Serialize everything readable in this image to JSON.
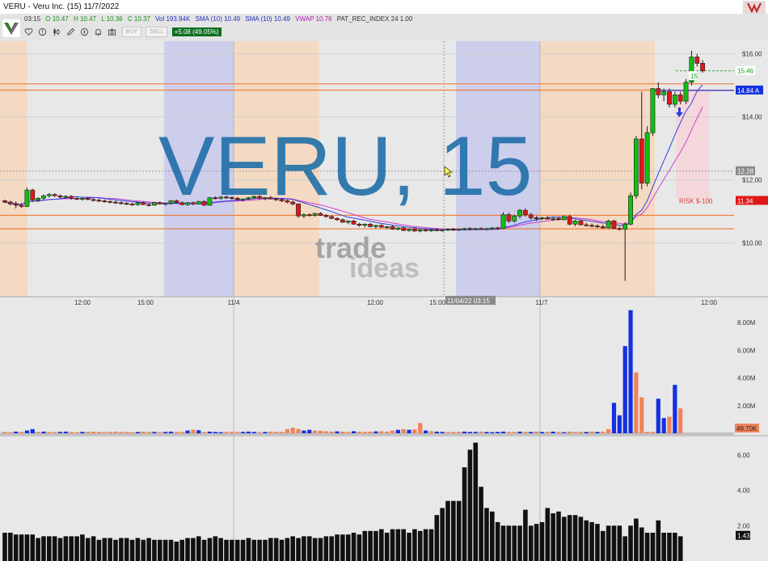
{
  "window": {
    "title": "VERU - Veru Inc. (15) 11/7/2022"
  },
  "quote": {
    "time": "03:15",
    "open": "O 10.47",
    "high": "H 10.47",
    "low": "L 10.36",
    "close": "C 10.37",
    "volume": "Vol 193.94K",
    "sma1": "SMA (10) 10.49",
    "sma2": "SMA (10) 10.49",
    "vwap": "VWAP 10.76",
    "pat": "PAT_REC_INDEX 24 1.00"
  },
  "toolbar": {
    "icons": [
      "heart-icon",
      "alert-icon",
      "candlestick-icon",
      "pencil-icon",
      "compass-icon",
      "bell-icon",
      "camera-icon"
    ],
    "buy_label": "BUY",
    "sell_label": "SELL",
    "change": "+5.08 (49.05%)"
  },
  "watermark": {
    "symbol": "VERU, 15",
    "brand_top": "trade",
    "brand_bottom": "ideas"
  },
  "colors": {
    "up": "#11c011",
    "down": "#e01818",
    "volume_up": "#1530e0",
    "volume_down": "#f0825a",
    "sma": "#3040e0",
    "vwap": "#d040d0",
    "level_line": "#f08040",
    "session_pre": "#f6d6bc",
    "session_post": "#c8c8ec"
  },
  "chart_data": {
    "type": "candlestick",
    "symbol": "VERU",
    "interval": "15",
    "price_axis": {
      "ticks": [
        "$16.00",
        "$14.00",
        "$12.00",
        "$10.00"
      ],
      "range": [
        8.3,
        16.4
      ]
    },
    "time_axis": {
      "ticks": [
        "12:00",
        "15:00",
        "11/4",
        "12:00",
        "15:00",
        "11/7",
        "12:00"
      ]
    },
    "crosshair": {
      "time_label": "11/04/22 03:15",
      "price_label": "12.28"
    },
    "price_labels": {
      "last": "15.46",
      "vwap": "14.84 A",
      "risk_price": "11.34",
      "avg_price": "15"
    },
    "risk_label": "RISK $-100",
    "horizontal_levels": [
      15.05,
      14.85,
      10.88,
      10.45
    ],
    "candles": [
      {
        "o": 11.34,
        "h": 11.38,
        "l": 11.26,
        "c": 11.3
      },
      {
        "o": 11.3,
        "h": 11.34,
        "l": 11.2,
        "c": 11.24
      },
      {
        "o": 11.24,
        "h": 11.32,
        "l": 11.1,
        "c": 11.2
      },
      {
        "o": 11.2,
        "h": 11.26,
        "l": 11.12,
        "c": 11.16
      },
      {
        "o": 11.16,
        "h": 11.76,
        "l": 11.14,
        "c": 11.68
      },
      {
        "o": 11.68,
        "h": 11.72,
        "l": 11.3,
        "c": 11.36
      },
      {
        "o": 11.36,
        "h": 11.46,
        "l": 11.3,
        "c": 11.42
      },
      {
        "o": 11.42,
        "h": 11.54,
        "l": 11.36,
        "c": 11.5
      },
      {
        "o": 11.5,
        "h": 11.58,
        "l": 11.44,
        "c": 11.54
      },
      {
        "o": 11.54,
        "h": 11.58,
        "l": 11.46,
        "c": 11.5
      },
      {
        "o": 11.5,
        "h": 11.54,
        "l": 11.42,
        "c": 11.46
      },
      {
        "o": 11.46,
        "h": 11.52,
        "l": 11.4,
        "c": 11.48
      },
      {
        "o": 11.48,
        "h": 11.52,
        "l": 11.38,
        "c": 11.42
      },
      {
        "o": 11.42,
        "h": 11.46,
        "l": 11.36,
        "c": 11.4
      },
      {
        "o": 11.4,
        "h": 11.44,
        "l": 11.34,
        "c": 11.42
      },
      {
        "o": 11.42,
        "h": 11.46,
        "l": 11.36,
        "c": 11.38
      },
      {
        "o": 11.38,
        "h": 11.42,
        "l": 11.32,
        "c": 11.36
      },
      {
        "o": 11.36,
        "h": 11.4,
        "l": 11.3,
        "c": 11.34
      },
      {
        "o": 11.34,
        "h": 11.38,
        "l": 11.28,
        "c": 11.32
      },
      {
        "o": 11.32,
        "h": 11.36,
        "l": 11.26,
        "c": 11.3
      },
      {
        "o": 11.3,
        "h": 11.34,
        "l": 11.24,
        "c": 11.28
      },
      {
        "o": 11.28,
        "h": 11.32,
        "l": 11.22,
        "c": 11.26
      },
      {
        "o": 11.26,
        "h": 11.3,
        "l": 11.2,
        "c": 11.24
      },
      {
        "o": 11.24,
        "h": 11.28,
        "l": 11.18,
        "c": 11.22
      },
      {
        "o": 11.22,
        "h": 11.3,
        "l": 11.18,
        "c": 11.28
      },
      {
        "o": 11.28,
        "h": 11.32,
        "l": 11.2,
        "c": 11.22
      },
      {
        "o": 11.22,
        "h": 11.26,
        "l": 11.16,
        "c": 11.2
      },
      {
        "o": 11.2,
        "h": 11.3,
        "l": 11.18,
        "c": 11.28
      },
      {
        "o": 11.28,
        "h": 11.32,
        "l": 11.22,
        "c": 11.24
      },
      {
        "o": 11.24,
        "h": 11.28,
        "l": 11.18,
        "c": 11.26
      },
      {
        "o": 11.26,
        "h": 11.36,
        "l": 11.22,
        "c": 11.34
      },
      {
        "o": 11.34,
        "h": 11.38,
        "l": 11.26,
        "c": 11.28
      },
      {
        "o": 11.28,
        "h": 11.32,
        "l": 11.2,
        "c": 11.22
      },
      {
        "o": 11.22,
        "h": 11.3,
        "l": 11.18,
        "c": 11.28
      },
      {
        "o": 11.28,
        "h": 11.32,
        "l": 11.2,
        "c": 11.24
      },
      {
        "o": 11.24,
        "h": 11.34,
        "l": 11.22,
        "c": 11.32
      },
      {
        "o": 11.32,
        "h": 11.36,
        "l": 11.18,
        "c": 11.2
      },
      {
        "o": 11.2,
        "h": 11.46,
        "l": 11.18,
        "c": 11.44
      },
      {
        "o": 11.44,
        "h": 11.48,
        "l": 11.38,
        "c": 11.42
      },
      {
        "o": 11.42,
        "h": 11.48,
        "l": 11.38,
        "c": 11.46
      },
      {
        "o": 11.46,
        "h": 11.5,
        "l": 11.4,
        "c": 11.44
      },
      {
        "o": 11.44,
        "h": 11.48,
        "l": 11.38,
        "c": 11.42
      },
      {
        "o": 11.42,
        "h": 11.46,
        "l": 11.34,
        "c": 11.38
      },
      {
        "o": 11.38,
        "h": 11.42,
        "l": 11.32,
        "c": 11.4
      },
      {
        "o": 11.4,
        "h": 11.46,
        "l": 11.36,
        "c": 11.44
      },
      {
        "o": 11.44,
        "h": 11.5,
        "l": 11.4,
        "c": 11.48
      },
      {
        "o": 11.48,
        "h": 11.52,
        "l": 11.38,
        "c": 11.42
      },
      {
        "o": 11.42,
        "h": 11.46,
        "l": 11.36,
        "c": 11.44
      },
      {
        "o": 11.44,
        "h": 11.5,
        "l": 11.38,
        "c": 11.4
      },
      {
        "o": 11.4,
        "h": 11.44,
        "l": 11.34,
        "c": 11.38
      },
      {
        "o": 11.38,
        "h": 11.42,
        "l": 11.3,
        "c": 11.34
      },
      {
        "o": 11.34,
        "h": 11.38,
        "l": 11.26,
        "c": 11.3
      },
      {
        "o": 11.3,
        "h": 11.34,
        "l": 11.2,
        "c": 11.24
      },
      {
        "o": 11.24,
        "h": 11.26,
        "l": 10.8,
        "c": 10.86
      },
      {
        "o": 10.86,
        "h": 10.94,
        "l": 10.8,
        "c": 10.9
      },
      {
        "o": 10.9,
        "h": 10.94,
        "l": 10.84,
        "c": 10.88
      },
      {
        "o": 10.88,
        "h": 10.96,
        "l": 10.84,
        "c": 10.94
      },
      {
        "o": 10.94,
        "h": 10.98,
        "l": 10.86,
        "c": 10.88
      },
      {
        "o": 10.88,
        "h": 10.92,
        "l": 10.8,
        "c": 10.84
      },
      {
        "o": 10.84,
        "h": 10.88,
        "l": 10.76,
        "c": 10.78
      },
      {
        "o": 10.78,
        "h": 10.82,
        "l": 10.7,
        "c": 10.74
      },
      {
        "o": 10.74,
        "h": 10.78,
        "l": 10.64,
        "c": 10.66
      },
      {
        "o": 10.66,
        "h": 10.72,
        "l": 10.6,
        "c": 10.7
      },
      {
        "o": 10.7,
        "h": 10.74,
        "l": 10.58,
        "c": 10.6
      },
      {
        "o": 10.6,
        "h": 10.64,
        "l": 10.52,
        "c": 10.56
      },
      {
        "o": 10.56,
        "h": 10.62,
        "l": 10.5,
        "c": 10.6
      },
      {
        "o": 10.6,
        "h": 10.64,
        "l": 10.5,
        "c": 10.52
      },
      {
        "o": 10.52,
        "h": 10.58,
        "l": 10.46,
        "c": 10.56
      },
      {
        "o": 10.56,
        "h": 10.6,
        "l": 10.48,
        "c": 10.5
      },
      {
        "o": 10.5,
        "h": 10.54,
        "l": 10.44,
        "c": 10.52
      },
      {
        "o": 10.52,
        "h": 10.56,
        "l": 10.42,
        "c": 10.44
      },
      {
        "o": 10.44,
        "h": 10.5,
        "l": 10.4,
        "c": 10.48
      },
      {
        "o": 10.48,
        "h": 10.52,
        "l": 10.38,
        "c": 10.4
      },
      {
        "o": 10.4,
        "h": 10.46,
        "l": 10.36,
        "c": 10.44
      },
      {
        "o": 10.44,
        "h": 10.48,
        "l": 10.36,
        "c": 10.38
      },
      {
        "o": 10.38,
        "h": 10.44,
        "l": 10.34,
        "c": 10.42
      },
      {
        "o": 10.42,
        "h": 10.46,
        "l": 10.36,
        "c": 10.4
      },
      {
        "o": 10.4,
        "h": 10.44,
        "l": 10.36,
        "c": 10.42
      },
      {
        "o": 10.42,
        "h": 10.46,
        "l": 10.38,
        "c": 10.4
      },
      {
        "o": 10.4,
        "h": 10.44,
        "l": 10.36,
        "c": 10.42
      },
      {
        "o": 10.42,
        "h": 10.46,
        "l": 10.38,
        "c": 10.44
      },
      {
        "o": 10.44,
        "h": 10.48,
        "l": 10.38,
        "c": 10.42
      },
      {
        "o": 10.42,
        "h": 10.46,
        "l": 10.38,
        "c": 10.44
      },
      {
        "o": 10.44,
        "h": 10.48,
        "l": 10.4,
        "c": 10.46
      },
      {
        "o": 10.46,
        "h": 10.5,
        "l": 10.4,
        "c": 10.44
      },
      {
        "o": 10.44,
        "h": 10.48,
        "l": 10.4,
        "c": 10.46
      },
      {
        "o": 10.46,
        "h": 10.5,
        "l": 10.42,
        "c": 10.44
      },
      {
        "o": 10.44,
        "h": 10.48,
        "l": 10.4,
        "c": 10.46
      },
      {
        "o": 10.46,
        "h": 10.5,
        "l": 10.42,
        "c": 10.48
      },
      {
        "o": 10.48,
        "h": 10.52,
        "l": 10.42,
        "c": 10.46
      },
      {
        "o": 10.46,
        "h": 10.98,
        "l": 10.44,
        "c": 10.9
      },
      {
        "o": 10.9,
        "h": 10.96,
        "l": 10.64,
        "c": 10.7
      },
      {
        "o": 10.7,
        "h": 10.9,
        "l": 10.64,
        "c": 10.86
      },
      {
        "o": 10.86,
        "h": 11.08,
        "l": 10.78,
        "c": 11.04
      },
      {
        "o": 11.04,
        "h": 11.1,
        "l": 10.84,
        "c": 10.9
      },
      {
        "o": 10.9,
        "h": 10.96,
        "l": 10.74,
        "c": 10.8
      },
      {
        "o": 10.8,
        "h": 10.86,
        "l": 10.7,
        "c": 10.78
      },
      {
        "o": 10.78,
        "h": 10.84,
        "l": 10.72,
        "c": 10.8
      },
      {
        "o": 10.8,
        "h": 10.86,
        "l": 10.74,
        "c": 10.76
      },
      {
        "o": 10.76,
        "h": 10.82,
        "l": 10.7,
        "c": 10.78
      },
      {
        "o": 10.78,
        "h": 10.84,
        "l": 10.72,
        "c": 10.74
      },
      {
        "o": 10.74,
        "h": 10.88,
        "l": 10.72,
        "c": 10.84
      },
      {
        "o": 10.84,
        "h": 10.9,
        "l": 10.56,
        "c": 10.6
      },
      {
        "o": 10.6,
        "h": 10.74,
        "l": 10.54,
        "c": 10.7
      },
      {
        "o": 10.7,
        "h": 10.74,
        "l": 10.56,
        "c": 10.58
      },
      {
        "o": 10.58,
        "h": 10.64,
        "l": 10.52,
        "c": 10.56
      },
      {
        "o": 10.56,
        "h": 10.62,
        "l": 10.5,
        "c": 10.54
      },
      {
        "o": 10.54,
        "h": 10.6,
        "l": 10.48,
        "c": 10.52
      },
      {
        "o": 10.52,
        "h": 10.58,
        "l": 10.46,
        "c": 10.48
      },
      {
        "o": 10.48,
        "h": 10.74,
        "l": 10.46,
        "c": 10.7
      },
      {
        "o": 10.7,
        "h": 10.74,
        "l": 10.44,
        "c": 10.46
      },
      {
        "o": 10.46,
        "h": 10.52,
        "l": 10.4,
        "c": 10.44
      },
      {
        "o": 10.44,
        "h": 10.66,
        "l": 8.8,
        "c": 10.6
      },
      {
        "o": 10.6,
        "h": 11.6,
        "l": 10.56,
        "c": 11.5
      },
      {
        "o": 11.5,
        "h": 13.4,
        "l": 11.4,
        "c": 13.3
      },
      {
        "o": 13.3,
        "h": 14.8,
        "l": 11.7,
        "c": 11.9
      },
      {
        "o": 11.9,
        "h": 13.7,
        "l": 11.8,
        "c": 13.5
      },
      {
        "o": 13.5,
        "h": 14.9,
        "l": 13.4,
        "c": 14.9
      },
      {
        "o": 14.9,
        "h": 15.1,
        "l": 14.6,
        "c": 14.7
      },
      {
        "o": 14.7,
        "h": 14.9,
        "l": 14.5,
        "c": 14.8
      },
      {
        "o": 14.8,
        "h": 14.9,
        "l": 14.3,
        "c": 14.4
      },
      {
        "o": 14.4,
        "h": 14.8,
        "l": 14.3,
        "c": 14.7
      },
      {
        "o": 14.7,
        "h": 14.8,
        "l": 14.4,
        "c": 14.5
      },
      {
        "o": 14.5,
        "h": 15.2,
        "l": 14.4,
        "c": 15.1
      },
      {
        "o": 15.1,
        "h": 16.1,
        "l": 15.0,
        "c": 15.9
      },
      {
        "o": 15.9,
        "h": 16.0,
        "l": 15.6,
        "c": 15.7
      },
      {
        "o": 15.7,
        "h": 15.8,
        "l": 15.4,
        "c": 15.46
      }
    ],
    "volume_panel": {
      "ticks": [
        "8.00M",
        "6.00M",
        "4.00M",
        "2.00M"
      ],
      "range": [
        0,
        9
      ],
      "last_label": "49.70K",
      "values": [
        0.1,
        0.08,
        0.12,
        0.1,
        0.2,
        0.3,
        0.1,
        0.12,
        0.1,
        0.08,
        0.1,
        0.12,
        0.1,
        0.08,
        0.1,
        0.1,
        0.12,
        0.1,
        0.08,
        0.1,
        0.12,
        0.1,
        0.1,
        0.08,
        0.1,
        0.12,
        0.1,
        0.1,
        0.08,
        0.1,
        0.12,
        0.1,
        0.1,
        0.2,
        0.26,
        0.22,
        0.1,
        0.12,
        0.1,
        0.08,
        0.1,
        0.12,
        0.1,
        0.1,
        0.12,
        0.1,
        0.08,
        0.1,
        0.12,
        0.1,
        0.1,
        0.3,
        0.4,
        0.3,
        0.2,
        0.25,
        0.2,
        0.18,
        0.15,
        0.12,
        0.14,
        0.12,
        0.1,
        0.15,
        0.12,
        0.1,
        0.12,
        0.14,
        0.15,
        0.12,
        0.2,
        0.25,
        0.3,
        0.25,
        0.28,
        0.74,
        0.2,
        0.15,
        0.12,
        0.1,
        0.08,
        0.1,
        0.1,
        0.12,
        0.1,
        0.1,
        0.12,
        0.1,
        0.08,
        0.1,
        0.12,
        0.1,
        0.1,
        0.12,
        0.1,
        0.1,
        0.12,
        0.1,
        0.1,
        0.12,
        0.1,
        0.08,
        0.12,
        0.1,
        0.1,
        0.1,
        0.12,
        0.1,
        0.12,
        0.3,
        2.2,
        1.3,
        6.3,
        8.9,
        4.4,
        2.6,
        0.1,
        0.1,
        2.5,
        1.1,
        1.2,
        3.5,
        1.8
      ],
      "up": [
        0,
        0,
        1,
        0,
        1,
        1,
        0,
        1,
        0,
        0,
        1,
        1,
        0,
        0,
        1,
        0,
        0,
        0,
        0,
        0,
        0,
        0,
        0,
        0,
        1,
        0,
        0,
        1,
        0,
        1,
        1,
        0,
        0,
        1,
        0,
        1,
        0,
        1,
        1,
        1,
        0,
        0,
        0,
        1,
        1,
        1,
        0,
        1,
        0,
        0,
        0,
        0,
        0,
        0,
        1,
        1,
        0,
        0,
        0,
        0,
        1,
        0,
        0,
        1,
        0,
        0,
        0,
        1,
        0,
        0,
        0,
        1,
        0,
        1,
        0,
        0,
        1,
        0,
        1,
        1,
        0,
        0,
        0,
        1,
        1,
        1,
        0,
        1,
        1,
        1,
        1,
        0,
        0,
        1,
        0,
        1,
        0,
        1,
        0,
        1,
        0,
        1,
        0,
        0,
        0,
        1,
        0,
        1,
        0,
        0,
        1,
        1,
        1,
        1,
        0,
        0,
        0,
        0,
        1,
        1,
        0,
        1,
        0
      ]
    },
    "indicator_panel": {
      "ticks": [
        "6.00",
        "4.00",
        "2.00"
      ],
      "range": [
        0,
        7
      ],
      "last_label": "1.43",
      "values": [
        1.6,
        1.6,
        1.5,
        1.5,
        1.5,
        1.5,
        1.3,
        1.4,
        1.4,
        1.4,
        1.3,
        1.4,
        1.4,
        1.4,
        1.5,
        1.3,
        1.4,
        1.2,
        1.3,
        1.3,
        1.2,
        1.3,
        1.3,
        1.2,
        1.3,
        1.2,
        1.3,
        1.2,
        1.2,
        1.2,
        1.2,
        1.1,
        1.2,
        1.3,
        1.3,
        1.4,
        1.2,
        1.3,
        1.4,
        1.3,
        1.2,
        1.2,
        1.2,
        1.2,
        1.3,
        1.2,
        1.2,
        1.2,
        1.3,
        1.3,
        1.2,
        1.3,
        1.4,
        1.3,
        1.4,
        1.4,
        1.3,
        1.3,
        1.4,
        1.4,
        1.5,
        1.5,
        1.5,
        1.6,
        1.5,
        1.7,
        1.7,
        1.7,
        1.8,
        1.6,
        1.8,
        1.8,
        1.8,
        1.6,
        1.8,
        1.7,
        1.8,
        1.8,
        2.6,
        3.0,
        3.4,
        3.4,
        3.4,
        5.3,
        6.3,
        6.7,
        4.2,
        3.0,
        2.8,
        2.2,
        2.0,
        2.0,
        2.0,
        2.0,
        2.9,
        2.0,
        2.1,
        2.2,
        3.0,
        2.7,
        2.8,
        2.5,
        2.6,
        2.6,
        2.5,
        2.3,
        2.2,
        2.1,
        1.7,
        2.0,
        2.0,
        2.0,
        1.4,
        2.0,
        2.4,
        1.9,
        1.6,
        1.6,
        2.3,
        1.6,
        1.6,
        1.6,
        1.4
      ]
    }
  }
}
